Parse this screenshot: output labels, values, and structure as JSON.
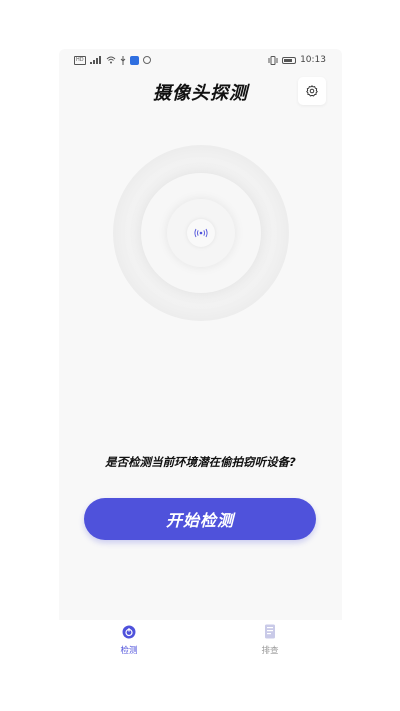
{
  "status_bar": {
    "left_icons": [
      "hd-icon",
      "signal-icon",
      "wifi-icon",
      "usb-icon",
      "app-notification-icon",
      "vpn-icon"
    ],
    "vibrate_icon": "vibrate-icon",
    "battery_icon": "battery-icon",
    "time": "10:13"
  },
  "header": {
    "title": "摄像头探测",
    "settings_icon": "settings-icon"
  },
  "radar": {
    "center_icon": "signal-broadcast-icon"
  },
  "main": {
    "question": "是否检测当前环境潜在偷拍窃听设备?",
    "start_button": "开始检测"
  },
  "bottom_nav": {
    "items": [
      {
        "label": "检测",
        "icon": "detect-icon",
        "active": true
      },
      {
        "label": "排查",
        "icon": "check-icon",
        "active": false
      }
    ]
  },
  "colors": {
    "accent": "#4f52db",
    "background": "#f8f8f8",
    "inactive": "#999999"
  }
}
